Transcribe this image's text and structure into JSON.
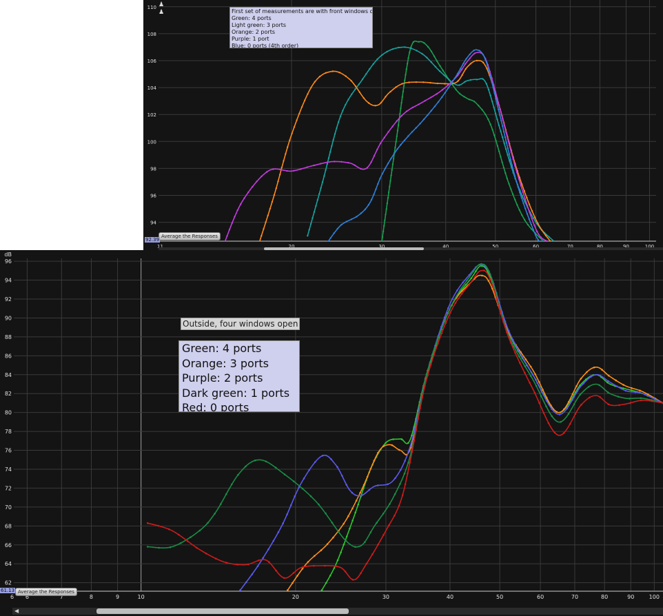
{
  "top": {
    "note_lines": [
      "First set of measurements are with front windows open",
      "Green: 4 ports",
      "Light green: 3 ports",
      "Orange: 2 ports",
      "Purple: 1 port",
      "Blue: 0 ports (4th order)"
    ],
    "average_button": "Average the Responses",
    "left_readout": "92.39",
    "axis_left_label": "11"
  },
  "bottom": {
    "title": "Outside, four windows open",
    "note_lines": [
      "Green: 4 ports",
      "Orange: 3 ports",
      "Purple: 2 ports",
      "Dark green: 1 ports",
      "Red: 0 ports"
    ],
    "average_button": "Average the Responses",
    "left_readout": "61.13",
    "axis_left_label": "6"
  },
  "chart_data": [
    {
      "type": "line",
      "xscale": "log",
      "xlim": [
        11,
        103
      ],
      "ylim": [
        92.6,
        110.5
      ],
      "xticks": [
        20,
        30,
        40,
        50,
        60,
        70,
        80,
        90,
        100
      ],
      "yticks": [
        94,
        96,
        98,
        100,
        102,
        104,
        106,
        108,
        110
      ],
      "ylabel": "",
      "series": [
        {
          "name": "Green: 4 ports",
          "color": "#1a9f50",
          "points": [
            [
              30,
              92.5
            ],
            [
              32,
              100
            ],
            [
              34,
              106.6
            ],
            [
              35.5,
              107.4
            ],
            [
              37,
              107
            ],
            [
              39,
              105.6
            ],
            [
              42,
              103.8
            ],
            [
              44,
              103.2
            ],
            [
              46,
              102.8
            ],
            [
              49,
              101.2
            ],
            [
              53,
              97
            ],
            [
              57,
              94.2
            ],
            [
              62,
              92.6
            ]
          ]
        },
        {
          "name": "Light green: 3 ports",
          "color": "#17a3a0",
          "points": [
            [
              21.5,
              93
            ],
            [
              23,
              97
            ],
            [
              25,
              102
            ],
            [
              27.5,
              104.6
            ],
            [
              30,
              106.4
            ],
            [
              33,
              107
            ],
            [
              36,
              106.5
            ],
            [
              39,
              105.2
            ],
            [
              42,
              104.2
            ],
            [
              44,
              104.5
            ],
            [
              46,
              104.6
            ],
            [
              48,
              104.3
            ],
            [
              51,
              101
            ],
            [
              55,
              97
            ],
            [
              60,
              94
            ],
            [
              65,
              92.6
            ]
          ]
        },
        {
          "name": "Orange: 2 ports",
          "color": "#ff8a1c",
          "points": [
            [
              17.3,
              92.5
            ],
            [
              18.5,
              96
            ],
            [
              20,
              100.5
            ],
            [
              22,
              104.2
            ],
            [
              24,
              105.2
            ],
            [
              26,
              104.6
            ],
            [
              28,
              103
            ],
            [
              29.5,
              102.7
            ],
            [
              31,
              103.6
            ],
            [
              33,
              104.3
            ],
            [
              36,
              104.4
            ],
            [
              39,
              104.3
            ],
            [
              42,
              104.4
            ],
            [
              44,
              105.5
            ],
            [
              46,
              106
            ],
            [
              48,
              105.5
            ],
            [
              51,
              102.5
            ],
            [
              55,
              98
            ],
            [
              60,
              94.2
            ],
            [
              64,
              92.6
            ]
          ]
        },
        {
          "name": "Purple: 1 port",
          "color": "#c43ce0",
          "points": [
            [
              14.8,
              92.5
            ],
            [
              16,
              95.5
            ],
            [
              18,
              97.8
            ],
            [
              20,
              97.8
            ],
            [
              22,
              98.2
            ],
            [
              24,
              98.5
            ],
            [
              26,
              98.4
            ],
            [
              28,
              98
            ],
            [
              30,
              100
            ],
            [
              33,
              102
            ],
            [
              36,
              102.9
            ],
            [
              39,
              103.7
            ],
            [
              42,
              104.8
            ],
            [
              44,
              105.9
            ],
            [
              46,
              106.6
            ],
            [
              48,
              106
            ],
            [
              51,
              102.5
            ],
            [
              55,
              97.8
            ],
            [
              60,
              93.5
            ],
            [
              63,
              92.6
            ]
          ]
        },
        {
          "name": "Blue: 0 ports (4th order)",
          "color": "#2f7fd8",
          "points": [
            [
              23.5,
              92.5
            ],
            [
              25,
              93.8
            ],
            [
              27,
              94.5
            ],
            [
              28.5,
              95.5
            ],
            [
              30,
              97.5
            ],
            [
              32,
              99.3
            ],
            [
              34,
              100.5
            ],
            [
              36,
              101.5
            ],
            [
              39,
              103.1
            ],
            [
              42,
              104.9
            ],
            [
              44,
              106.2
            ],
            [
              46,
              106.8
            ],
            [
              48,
              105.9
            ],
            [
              51,
              102
            ],
            [
              55,
              97
            ],
            [
              60,
              93
            ],
            [
              62,
              92.6
            ]
          ]
        }
      ]
    },
    {
      "type": "line",
      "xscale": "log",
      "xlim": [
        5.65,
        104
      ],
      "ylim": [
        61.1,
        96.3
      ],
      "xticks": [
        6,
        7,
        8,
        9,
        10,
        20,
        30,
        40,
        50,
        60,
        70,
        80,
        90,
        100
      ],
      "yticks": [
        62,
        64,
        66,
        68,
        70,
        72,
        74,
        76,
        78,
        80,
        82,
        84,
        86,
        88,
        90,
        92,
        94,
        96
      ],
      "ylabel": "dB",
      "series": [
        {
          "name": "Green: 4 ports",
          "color": "#2ec82e",
          "points": [
            [
              22.5,
              61.2
            ],
            [
              24,
              64
            ],
            [
              26,
              69
            ],
            [
              28,
              74
            ],
            [
              30,
              76.8
            ],
            [
              32,
              77.2
            ],
            [
              33.5,
              77.2
            ],
            [
              36,
              84
            ],
            [
              40,
              91
            ],
            [
              44,
              94.2
            ],
            [
              46,
              95.5
            ],
            [
              48,
              94.2
            ],
            [
              52,
              88.5
            ],
            [
              58,
              84
            ],
            [
              65,
              80
            ],
            [
              72,
              83
            ],
            [
              77,
              84
            ],
            [
              82,
              83
            ],
            [
              88,
              82.5
            ],
            [
              95,
              82
            ],
            [
              104,
              81
            ]
          ]
        },
        {
          "name": "Orange: 3 ports",
          "color": "#ff8f1a",
          "points": [
            [
              19.3,
              61.2
            ],
            [
              21,
              64
            ],
            [
              23,
              66
            ],
            [
              25,
              68.5
            ],
            [
              27,
              72
            ],
            [
              29,
              75.8
            ],
            [
              30.5,
              76.6
            ],
            [
              32,
              76
            ],
            [
              33.5,
              76.2
            ],
            [
              36,
              84
            ],
            [
              40,
              91
            ],
            [
              44,
              93.8
            ],
            [
              46,
              94.5
            ],
            [
              48,
              93.5
            ],
            [
              52,
              88.5
            ],
            [
              58,
              84.5
            ],
            [
              65,
              80
            ],
            [
              72,
              83.6
            ],
            [
              77,
              84.8
            ],
            [
              82,
              83.8
            ],
            [
              88,
              82.8
            ],
            [
              95,
              82.2
            ],
            [
              104,
              81
            ]
          ]
        },
        {
          "name": "Purple: 2 ports",
          "color": "#5a5af0",
          "points": [
            [
              15.6,
              61.2
            ],
            [
              17,
              64
            ],
            [
              18.8,
              68
            ],
            [
              20.5,
              72.5
            ],
            [
              22.5,
              75.4
            ],
            [
              24,
              74.4
            ],
            [
              25.5,
              71.8
            ],
            [
              26.8,
              71.2
            ],
            [
              28.5,
              72.2
            ],
            [
              31,
              72.8
            ],
            [
              33.5,
              76.5
            ],
            [
              36,
              84
            ],
            [
              40,
              91.5
            ],
            [
              44,
              94.8
            ],
            [
              46,
              95.6
            ],
            [
              48,
              94.5
            ],
            [
              52,
              88.7
            ],
            [
              58,
              84
            ],
            [
              65,
              79.8
            ],
            [
              72,
              82.8
            ],
            [
              77,
              84
            ],
            [
              82,
              83.2
            ],
            [
              88,
              82.3
            ],
            [
              95,
              82
            ],
            [
              104,
              81
            ]
          ]
        },
        {
          "name": "Dark green: 1 ports",
          "color": "#1a8d46",
          "points": [
            [
              10.3,
              65.8
            ],
            [
              11.5,
              65.8
            ],
            [
              13,
              67.5
            ],
            [
              14,
              69.5
            ],
            [
              15.5,
              73.5
            ],
            [
              17,
              75
            ],
            [
              19,
              73.5
            ],
            [
              22,
              70.5
            ],
            [
              25,
              66.5
            ],
            [
              26.8,
              65.9
            ],
            [
              28.5,
              68
            ],
            [
              31,
              71
            ],
            [
              33.5,
              75.5
            ],
            [
              36,
              84
            ],
            [
              40,
              91
            ],
            [
              44,
              94.6
            ],
            [
              46,
              95.7
            ],
            [
              48,
              94.5
            ],
            [
              52,
              88.2
            ],
            [
              58,
              83.5
            ],
            [
              65,
              79
            ],
            [
              72,
              82
            ],
            [
              77,
              83
            ],
            [
              82,
              82
            ],
            [
              88,
              81.5
            ],
            [
              95,
              81.5
            ],
            [
              104,
              81
            ]
          ]
        },
        {
          "name": "Red: 0 ports",
          "color": "#cf1b1b",
          "points": [
            [
              10.3,
              68.3
            ],
            [
              11.5,
              67.5
            ],
            [
              13,
              65.5
            ],
            [
              14.5,
              64.2
            ],
            [
              16,
              63.9
            ],
            [
              17.5,
              64.4
            ],
            [
              19,
              62.5
            ],
            [
              20.5,
              63.6
            ],
            [
              22.5,
              63.8
            ],
            [
              24.5,
              63.6
            ],
            [
              26,
              62.3
            ],
            [
              27.5,
              64
            ],
            [
              30,
              67.5
            ],
            [
              32,
              70.5
            ],
            [
              33.5,
              75
            ],
            [
              36,
              83.5
            ],
            [
              40,
              90.5
            ],
            [
              44,
              93.8
            ],
            [
              46,
              95
            ],
            [
              48,
              94
            ],
            [
              52,
              88
            ],
            [
              58,
              82.5
            ],
            [
              65,
              77.6
            ],
            [
              72,
              80.8
            ],
            [
              77,
              81.8
            ],
            [
              82,
              80.8
            ],
            [
              88,
              80.9
            ],
            [
              95,
              81.3
            ],
            [
              104,
              81
            ]
          ]
        }
      ]
    }
  ]
}
